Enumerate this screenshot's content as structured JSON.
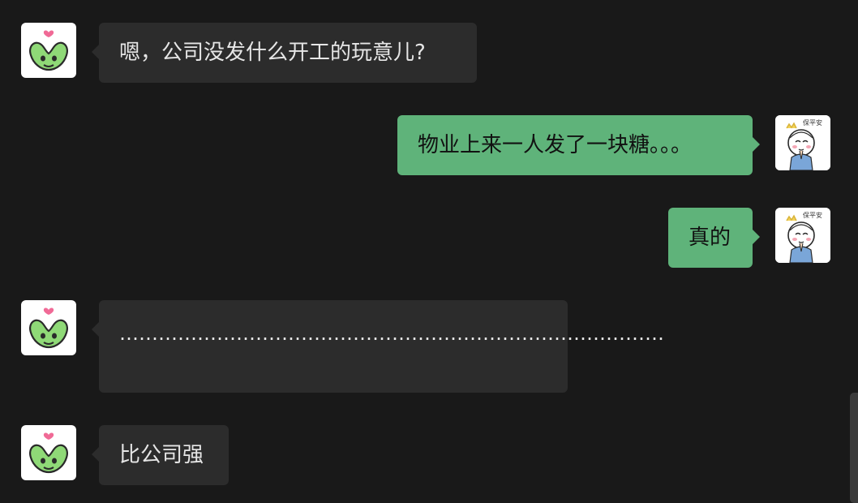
{
  "colors": {
    "background": "#191919",
    "incoming_bubble": "#2c2c2c",
    "outgoing_bubble": "#5fb37a",
    "incoming_text": "#e6e6e6",
    "outgoing_text": "#111111"
  },
  "avatars": {
    "contact": "frog-heart-sticker-icon",
    "self": "cartoon-kid-praying-icon"
  },
  "messages": [
    {
      "side": "incoming",
      "text": "嗯，公司没发什么开工的玩意儿?"
    },
    {
      "side": "outgoing",
      "text": "物业上来一人发了一块糖。。。"
    },
    {
      "side": "outgoing",
      "text": "真的"
    },
    {
      "side": "incoming",
      "text": "…………………………………………………………………………"
    },
    {
      "side": "incoming",
      "text": "比公司强"
    }
  ]
}
